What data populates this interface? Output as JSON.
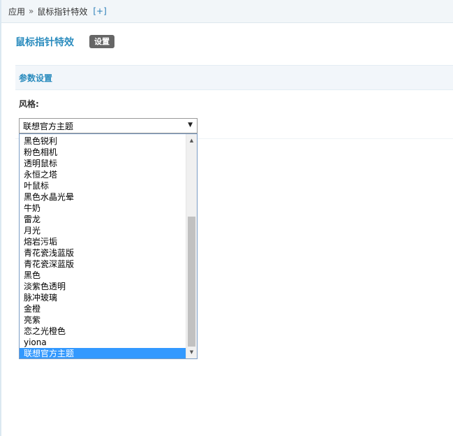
{
  "breadcrumb": {
    "root": "应用",
    "separator": "»",
    "current": "鼠标指针特效",
    "add": "[+]"
  },
  "plugin": {
    "title": "鼠标指针特效",
    "settings_badge": "设置"
  },
  "section": {
    "title": "参数设置"
  },
  "style_field": {
    "label": "风格:",
    "selected_value": "联想官方主题",
    "options": [
      "黑色锐利",
      "粉色相机",
      "透明鼠标",
      "永恒之塔",
      "叶鼠标",
      "黑色水晶光晕",
      "牛奶",
      "雷龙",
      "月光",
      "熔岩污垢",
      "青花瓷浅蓝版",
      "青花瓷深蓝版",
      "黑色",
      "淡紫色透明",
      "脉冲玻璃",
      "金橙",
      "亮紫",
      "恋之光橙色",
      "yiona",
      "联想官方主题"
    ],
    "highlighted_option": "联想官方主题"
  },
  "colors": {
    "accent": "#2b8cbe",
    "highlight": "#3399ff",
    "badge": "#666666"
  },
  "icons": {
    "select_arrow": "caret-down-icon",
    "scroll_up": "scroll-up-icon",
    "scroll_down": "scroll-down-icon"
  }
}
